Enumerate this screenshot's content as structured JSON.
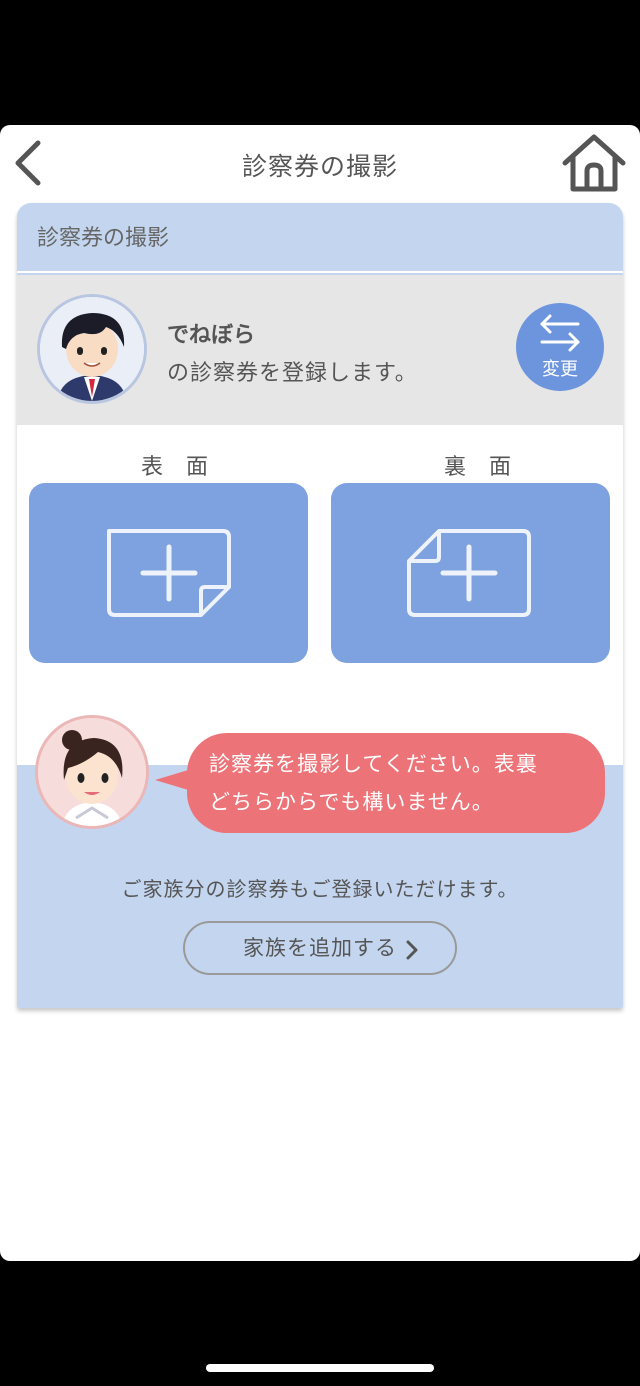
{
  "nav": {
    "title": "診察券の撮影"
  },
  "card": {
    "header": "診察券の撮影",
    "profile": {
      "name": "でねぼら",
      "description": "の診察券を登録します。",
      "change_label": "変更"
    },
    "front_label": "表 面",
    "back_label": "裏 面",
    "instruction_line1": "診察券を撮影してください。表裏",
    "instruction_line2": "どちらからでも構いません。",
    "family_text": "ご家族分の診察券もご登録いただけます。",
    "family_button": "家族を追加する"
  },
  "colors": {
    "accent_blue": "#7da2df",
    "change_button": "#6c95dd",
    "card_background": "#c4d6ef",
    "bubble": "#ec7377"
  },
  "icons": [
    "back-chevron-icon",
    "home-icon",
    "swap-arrows-icon",
    "add-card-front-icon",
    "add-card-back-icon",
    "chevron-right-icon"
  ]
}
